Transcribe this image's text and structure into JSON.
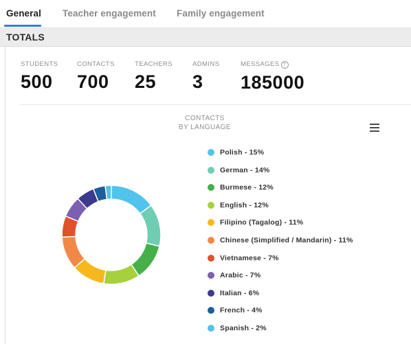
{
  "tabs": [
    {
      "label": "General",
      "active": true
    },
    {
      "label": "Teacher engagement",
      "active": false
    },
    {
      "label": "Family engagement",
      "active": false
    }
  ],
  "totals": {
    "title": "TOTALS",
    "stats": [
      {
        "label": "STUDENTS",
        "value": "500"
      },
      {
        "label": "CONTACTS",
        "value": "700"
      },
      {
        "label": "TEACHERS",
        "value": "25"
      },
      {
        "label": "ADMINS",
        "value": "3"
      },
      {
        "label": "MESSAGES",
        "value": "185000",
        "icon": "help-icon"
      }
    ]
  },
  "chart": {
    "title": "CONTACTS\nBY LANGUAGE",
    "menu_icon": "hamburger-menu-icon"
  },
  "chart_data": {
    "type": "pie",
    "title": "CONTACTS BY LANGUAGE",
    "donut": true,
    "legend_position": "right",
    "categories": [
      "Polish",
      "German",
      "Burmese",
      "English",
      "Filipino (Tagalog)",
      "Chinese (Simplified / Mandarin)",
      "Vietnamese",
      "Arabic",
      "Italian",
      "French",
      "Spanish"
    ],
    "values": [
      15,
      14,
      12,
      12,
      11,
      11,
      7,
      7,
      6,
      4,
      2
    ],
    "labels": [
      "Polish - 15%",
      "German - 14%",
      "Burmese - 12%",
      "English - 12%",
      "Filipino (Tagalog) - 11%",
      "Chinese (Simplified / Mandarin) - 11%",
      "Vietnamese - 7%",
      "Arabic - 7%",
      "Italian - 6%",
      "French - 4%",
      "Spanish - 2%"
    ],
    "colors": [
      "#52c3ec",
      "#6fcdb3",
      "#45b04a",
      "#a6d13b",
      "#f6b81c",
      "#f28847",
      "#e1512a",
      "#7b5fb0",
      "#3b3a8d",
      "#1d5f9a",
      "#52c3ec"
    ]
  }
}
